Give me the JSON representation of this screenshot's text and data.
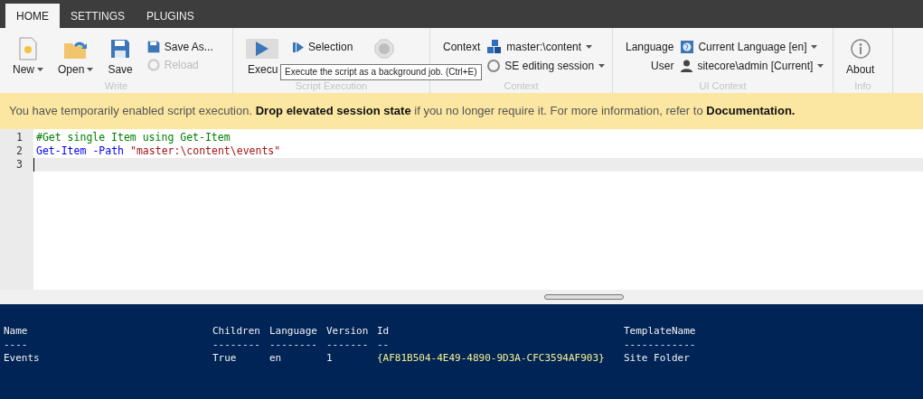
{
  "tabs": [
    {
      "label": "HOME",
      "selected": true
    },
    {
      "label": "SETTINGS",
      "selected": false
    },
    {
      "label": "PLUGINS",
      "selected": false
    }
  ],
  "ribbon": {
    "groups": [
      {
        "title": "Write",
        "items": [
          {
            "kind": "big",
            "label": "New",
            "dropdown": true
          },
          {
            "kind": "big",
            "label": "Open",
            "dropdown": true
          },
          {
            "kind": "big",
            "label": "Save",
            "dropdown": false
          },
          {
            "kind": "stack",
            "rows": [
              {
                "label": "Save As...",
                "disabled": false
              },
              {
                "label": "Reload",
                "disabled": true
              }
            ]
          }
        ]
      },
      {
        "title": "Script Execution",
        "items": [
          {
            "kind": "big",
            "label": "Execu",
            "hovered": true
          },
          {
            "kind": "stack",
            "rows": [
              {
                "label": "Selection",
                "disabled": false
              }
            ]
          },
          {
            "kind": "stop",
            "disabled": true
          }
        ]
      },
      {
        "title": "Context",
        "items": [
          {
            "kind": "fields",
            "rows": [
              {
                "label": "Context",
                "value": "master:\\content",
                "dropdown": true
              },
              {
                "value": "SE editing session",
                "dropdown": true
              }
            ]
          }
        ]
      },
      {
        "title": "UI Context",
        "items": [
          {
            "kind": "fields",
            "rows": [
              {
                "label": "Language",
                "value": "Current Language [en]",
                "dropdown": true
              },
              {
                "label": "User",
                "value": "sitecore\\admin [Current]",
                "dropdown": true
              }
            ]
          }
        ]
      },
      {
        "title": "Info",
        "items": [
          {
            "kind": "big",
            "label": "About",
            "dropdown": false
          }
        ]
      }
    ]
  },
  "tooltip": "Execute the script as a background job. (Ctrl+E)",
  "banner": "You have temporarily enabled script execution. **Drop elevated session state** if you no longer require it. For more information, refer to **Documentation.**",
  "editor": {
    "lines": [
      {
        "number": "1",
        "active": false,
        "tokens": [
          {
            "kind": "comment",
            "text": "#Get single Item using Get-Item"
          }
        ]
      },
      {
        "number": "2",
        "active": false,
        "tokens": [
          {
            "kind": "cmdlet",
            "text": "Get-Item"
          },
          {
            "kind": "param",
            "text": "-Path"
          },
          {
            "kind": "string",
            "text": "\"master:\\content\\events\""
          }
        ]
      },
      {
        "number": "3",
        "active": true
      }
    ]
  },
  "console": {
    "columns": [
      {
        "label": "Name",
        "rule": "----"
      },
      {
        "label": "Children",
        "rule": "--------"
      },
      {
        "label": "Language",
        "rule": "--------"
      },
      {
        "label": "Version",
        "rule": "-------"
      },
      {
        "label": "Id",
        "rule": "--"
      },
      {
        "label": "TemplateName",
        "rule": "------------"
      }
    ],
    "rows": [
      {
        "cells": [
          {
            "kind": "plain",
            "text": "Events"
          },
          {
            "kind": "plain",
            "text": "True"
          },
          {
            "kind": "plain",
            "text": "en"
          },
          {
            "kind": "plain",
            "text": "1"
          },
          {
            "kind": "guid",
            "text": "{AF81B504-4E49-4890-9D3A-CFC3594AF903}"
          },
          {
            "kind": "plain",
            "text": "Site Folder"
          }
        ]
      }
    ]
  }
}
